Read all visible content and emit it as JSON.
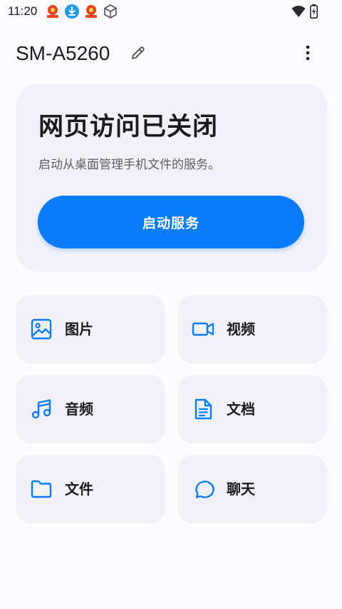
{
  "status_bar": {
    "time": "11:20",
    "left_icons": [
      "app-badge-icon",
      "download-icon",
      "app-badge-icon",
      "cube-icon"
    ],
    "right_icons": [
      "wifi-icon",
      "battery-charging-icon"
    ]
  },
  "header": {
    "device_name": "SM-A5260",
    "edit_icon": "pencil-icon",
    "more_icon": "more-vertical-icon"
  },
  "web_access": {
    "title": "网页访问已关闭",
    "description": "启动从桌面管理手机文件的服务。",
    "button_label": "启动服务"
  },
  "categories": [
    {
      "label": "图片",
      "icon": "image-icon"
    },
    {
      "label": "视频",
      "icon": "video-icon"
    },
    {
      "label": "音频",
      "icon": "music-icon"
    },
    {
      "label": "文档",
      "icon": "document-icon"
    },
    {
      "label": "文件",
      "icon": "folder-icon"
    },
    {
      "label": "聊天",
      "icon": "chat-icon"
    }
  ],
  "colors": {
    "accent": "#0a7cff",
    "card_background": "#f1f1fa",
    "page_background": "#fdfbff"
  }
}
